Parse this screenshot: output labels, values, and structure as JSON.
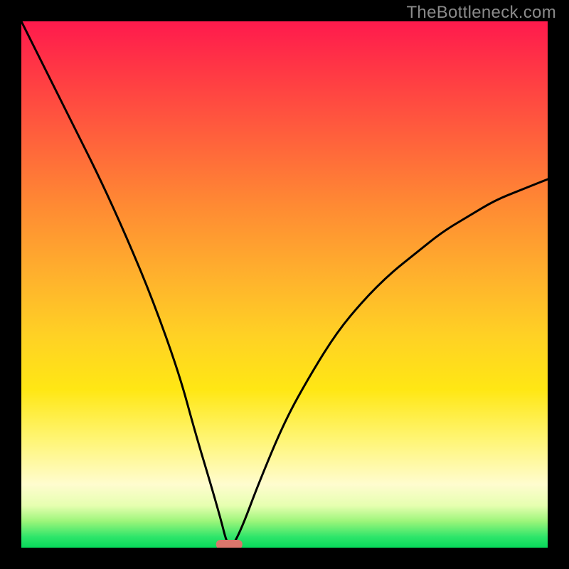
{
  "watermark": "TheBottleneck.com",
  "chart_data": {
    "type": "line",
    "title": "",
    "xlabel": "",
    "ylabel": "",
    "xlim": [
      0,
      100
    ],
    "ylim": [
      0,
      100
    ],
    "grid": false,
    "legend": false,
    "series": [
      {
        "name": "bottleneck-curve",
        "x": [
          0,
          5,
          10,
          15,
          20,
          25,
          30,
          33,
          36,
          38,
          39,
          40,
          42,
          45,
          50,
          55,
          60,
          65,
          70,
          75,
          80,
          85,
          90,
          95,
          100
        ],
        "values": [
          100,
          90,
          80,
          70,
          59,
          47,
          33,
          22,
          12,
          5,
          1,
          0,
          4,
          12,
          24,
          33,
          41,
          47,
          52,
          56,
          60,
          63,
          66,
          68,
          70
        ]
      }
    ],
    "marker": {
      "name": "target-marker",
      "x_start": 37,
      "x_end": 42,
      "y": 0,
      "color": "#db766c"
    },
    "background_gradient": {
      "top": "#ff1a4d",
      "mid_upper": "#ff8a33",
      "mid": "#ffe714",
      "mid_lower": "#fffccf",
      "bottom": "#07d95a"
    }
  }
}
